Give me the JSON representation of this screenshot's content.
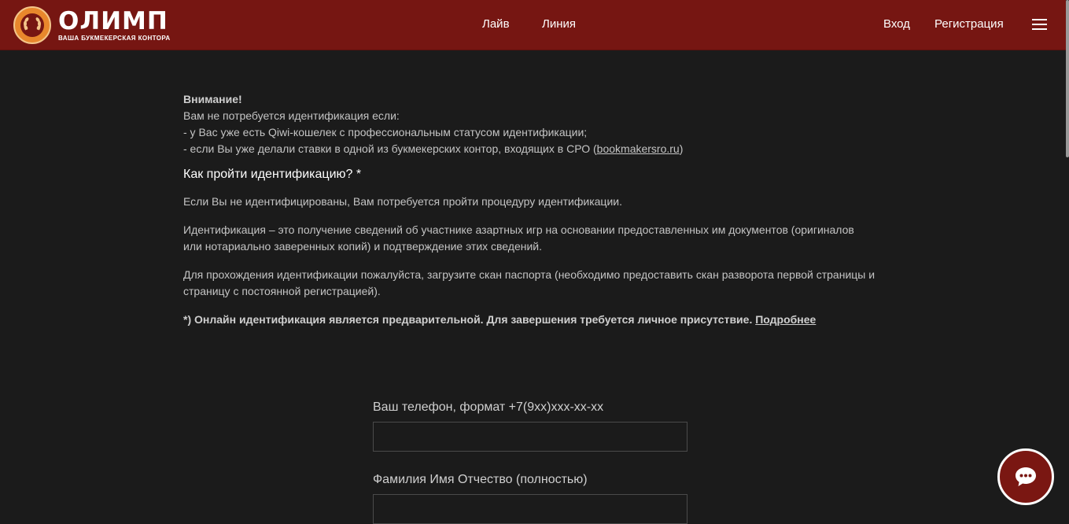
{
  "header": {
    "logo_word": "ОЛИМП",
    "logo_tagline": "ВАША БУКМЕКЕРСКАЯ КОНТОРА",
    "nav": {
      "live": "Лайв",
      "line": "Линия",
      "login": "Вход",
      "register": "Регистрация"
    },
    "colors": {
      "background": "#761612",
      "text": "#ffffff",
      "emblem": "#e8872c"
    }
  },
  "notice": {
    "title": "Внимание!",
    "intro": "Вам не потребуется идентификация если:",
    "item1": "- у Вас уже есть Qiwi-кошелек с профессиональным статусом идентификации;",
    "item2_prefix": "- если Вы уже делали ставки в одной из букмекерских контор, входящих в СРО (",
    "item2_link": "bookmakersro.ru",
    "item2_suffix": ")"
  },
  "howto": {
    "title": "Как пройти идентификацию? *",
    "para1": "Если Вы не идентифицированы, Вам потребуется пройти процедуру идентификации.",
    "para2": "Идентификация – это получение сведений об участнике азартных игр на основании предоставленных им документов (оригиналов или нотариально заверенных копий) и подтверждение этих сведений.",
    "para3": "Для прохождения идентификации пожалуйста, загрузите скан паспорта (необходимо предоставить скан разворота первой страницы и страницу с постоянной регистрацией).",
    "note": "*) Онлайн идентификация является предварительной. Для завершения требуется личное присутствие.",
    "note_link": "Подробнее"
  },
  "form": {
    "phone_label": "Ваш телефон, формат +7(9хх)ххх-хх-хх",
    "phone_value": "",
    "name_label": "Фамилия Имя Отчество (полностью)",
    "name_value": ""
  },
  "icons": {
    "logo": "laurel-wreath-icon",
    "menu": "hamburger-menu-icon",
    "chat": "chat-bubble-icon"
  },
  "colors": {
    "page_background": "#1b1b1b",
    "accent": "#761612",
    "text": "#c4c4c4"
  }
}
